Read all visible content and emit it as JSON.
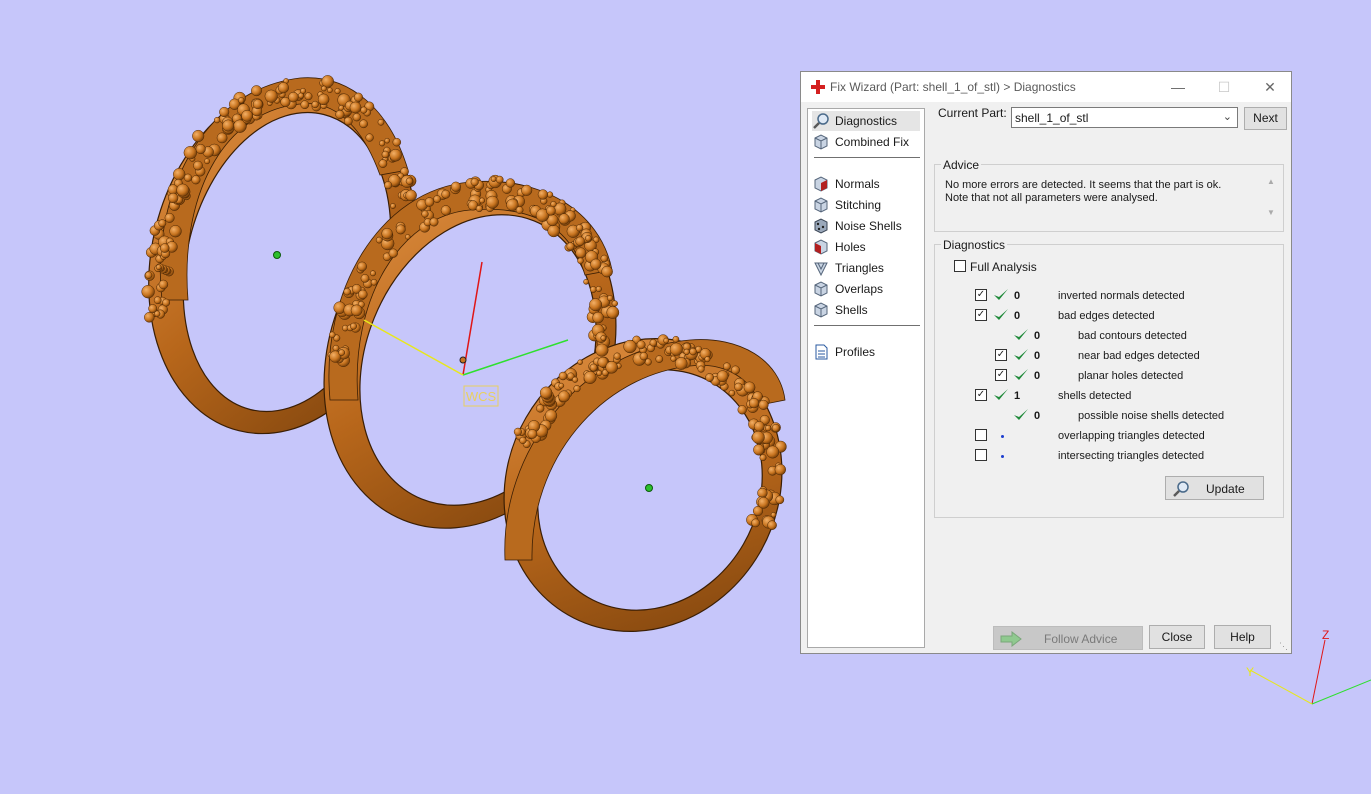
{
  "dialog": {
    "title": "Fix Wizard (Part: shell_1_of_stl) > Diagnostics",
    "minimize_icon": "minimize-icon",
    "maximize_icon": "maximize-icon",
    "close_icon": "close-icon"
  },
  "nav": {
    "items": [
      {
        "label": "Diagnostics",
        "icon": "magnifier-icon"
      },
      {
        "label": "Combined Fix",
        "icon": "cube-icon"
      },
      {
        "label": "Normals",
        "icon": "cube-normals-icon"
      },
      {
        "label": "Stitching",
        "icon": "cube-stitching-icon"
      },
      {
        "label": "Noise Shells",
        "icon": "cube-noise-icon"
      },
      {
        "label": "Holes",
        "icon": "cube-holes-icon"
      },
      {
        "label": "Triangles",
        "icon": "triangles-icon"
      },
      {
        "label": "Overlaps",
        "icon": "cube-overlaps-icon"
      },
      {
        "label": "Shells",
        "icon": "cube-shells-icon"
      },
      {
        "label": "Profiles",
        "icon": "document-icon"
      }
    ]
  },
  "current_part": {
    "label": "Current Part:",
    "value": "shell_1_of_stl",
    "next_label": "Next"
  },
  "advice": {
    "title": "Advice",
    "line1": "No more errors are detected. It seems that the part is ok.",
    "line2": "Note that not all parameters were analysed."
  },
  "diagnostics": {
    "title": "Diagnostics",
    "full_analysis_label": "Full Analysis",
    "full_analysis_checked": false,
    "rows": [
      {
        "count": "0",
        "label": "inverted normals detected"
      },
      {
        "count": "0",
        "label": "bad edges detected"
      },
      {
        "count": "0",
        "label": "bad contours detected"
      },
      {
        "count": "0",
        "label": "near bad edges detected"
      },
      {
        "count": "0",
        "label": "planar holes detected"
      },
      {
        "count": "1",
        "label": "shells detected"
      },
      {
        "count": "0",
        "label": "possible noise shells detected"
      },
      {
        "count": "",
        "label": "overlapping triangles detected"
      },
      {
        "count": "",
        "label": "intersecting triangles detected"
      }
    ],
    "update_label": "Update"
  },
  "footer": {
    "follow_advice_label": "Follow Advice",
    "close_label": "Close",
    "help_label": "Help"
  },
  "viewport": {
    "wcs_label": "WCS",
    "axis_z": "Z",
    "axis_y": "Y",
    "background": "#c6c6fa",
    "ring_color": "#c8741f"
  }
}
